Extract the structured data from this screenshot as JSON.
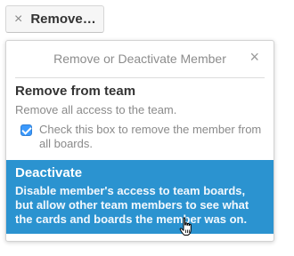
{
  "remove_button": {
    "icon": "close-icon",
    "label": "Remove…"
  },
  "popover": {
    "title": "Remove or Deactivate Member",
    "close_icon": "×",
    "remove_from_team": {
      "title": "Remove from team",
      "description": "Remove all access to the team.",
      "checkbox_checked": true,
      "checkbox_label": "Check this box to remove the member from all boards."
    },
    "deactivate": {
      "title": "Deactivate",
      "description": "Disable member's access to team boards, but allow other team members to see what the cards and boards the member was on."
    }
  },
  "colors": {
    "highlight": "#2b93d0",
    "checkbox": "#3b99fc"
  }
}
